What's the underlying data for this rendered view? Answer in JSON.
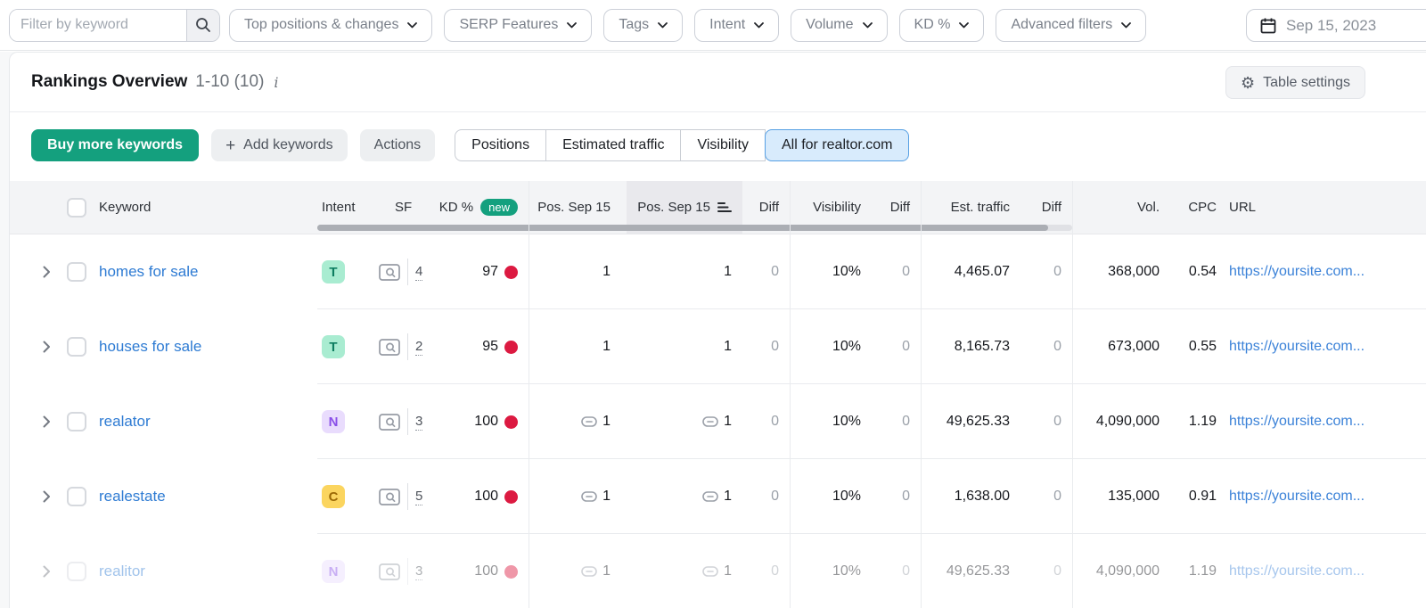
{
  "filters": {
    "keyword_placeholder": "Filter by keyword",
    "dropdowns": [
      {
        "id": "top-positions-changes",
        "label": "Top positions & changes"
      },
      {
        "id": "serp-features",
        "label": "SERP Features"
      },
      {
        "id": "tags",
        "label": "Tags"
      },
      {
        "id": "intent",
        "label": "Intent"
      },
      {
        "id": "volume",
        "label": "Volume"
      },
      {
        "id": "kd",
        "label": "KD %"
      },
      {
        "id": "advanced-filters",
        "label": "Advanced filters"
      }
    ],
    "date": "Sep 15, 2023"
  },
  "overview": {
    "title": "Rankings Overview",
    "range": "1-10 (10)",
    "table_settings_label": "Table settings"
  },
  "actions": {
    "buy_label": "Buy more keywords",
    "add_label": "Add keywords",
    "actions_label": "Actions",
    "view_tabs": [
      {
        "id": "positions",
        "label": "Positions",
        "active": false
      },
      {
        "id": "estimated-traffic",
        "label": "Estimated traffic",
        "active": false
      },
      {
        "id": "visibility",
        "label": "Visibility",
        "active": false
      },
      {
        "id": "all-for-domain",
        "label": "All for realtor.com",
        "active": true
      }
    ]
  },
  "table": {
    "new_badge_label": "new",
    "columns": [
      {
        "id": "keyword",
        "label": "Keyword"
      },
      {
        "id": "intent",
        "label": "Intent"
      },
      {
        "id": "sf",
        "label": "SF"
      },
      {
        "id": "kd",
        "label": "KD %",
        "badge": true
      },
      {
        "id": "pos1",
        "label": "Pos. Sep 15"
      },
      {
        "id": "pos2",
        "label": "Pos. Sep 15",
        "sorted": true
      },
      {
        "id": "diff1",
        "label": "Diff"
      },
      {
        "id": "visibility",
        "label": "Visibility"
      },
      {
        "id": "diff2",
        "label": "Diff"
      },
      {
        "id": "traffic",
        "label": "Est. traffic"
      },
      {
        "id": "diff3",
        "label": "Diff"
      },
      {
        "id": "vol",
        "label": "Vol."
      },
      {
        "id": "cpc",
        "label": "CPC"
      },
      {
        "id": "url",
        "label": "URL"
      }
    ],
    "intent_colors": {
      "T": {
        "bg": "#a9ecd1",
        "fg": "#0d7d60"
      },
      "N": {
        "bg": "#e9dcfd",
        "fg": "#8a4fe8"
      },
      "C": {
        "bg": "#fbd55f",
        "fg": "#9c6a06"
      }
    },
    "kd_dot_color": "#dc1a41",
    "rows": [
      {
        "keyword": "homes for sale",
        "intent": "T",
        "sf": "4",
        "kd": "97",
        "pos1": "1",
        "pos1_linked": false,
        "pos2": "1",
        "pos2_linked": false,
        "diff1": "0",
        "visibility": "10%",
        "diff2": "0",
        "traffic": "4,465.07",
        "diff3": "0",
        "vol": "368,000",
        "cpc": "0.54",
        "url": "https://yoursite.com...",
        "faded": false
      },
      {
        "keyword": "houses for sale",
        "intent": "T",
        "sf": "2",
        "kd": "95",
        "pos1": "1",
        "pos1_linked": false,
        "pos2": "1",
        "pos2_linked": false,
        "diff1": "0",
        "visibility": "10%",
        "diff2": "0",
        "traffic": "8,165.73",
        "diff3": "0",
        "vol": "673,000",
        "cpc": "0.55",
        "url": "https://yoursite.com...",
        "faded": false
      },
      {
        "keyword": "realator",
        "intent": "N",
        "sf": "3",
        "kd": "100",
        "pos1": "1",
        "pos1_linked": true,
        "pos2": "1",
        "pos2_linked": true,
        "diff1": "0",
        "visibility": "10%",
        "diff2": "0",
        "traffic": "49,625.33",
        "diff3": "0",
        "vol": "4,090,000",
        "cpc": "1.19",
        "url": "https://yoursite.com...",
        "faded": false
      },
      {
        "keyword": "realestate",
        "intent": "C",
        "sf": "5",
        "kd": "100",
        "pos1": "1",
        "pos1_linked": true,
        "pos2": "1",
        "pos2_linked": true,
        "diff1": "0",
        "visibility": "10%",
        "diff2": "0",
        "traffic": "1,638.00",
        "diff3": "0",
        "vol": "135,000",
        "cpc": "0.91",
        "url": "https://yoursite.com...",
        "faded": false
      },
      {
        "keyword": "realitor",
        "intent": "N",
        "sf": "3",
        "kd": "100",
        "pos1": "1",
        "pos1_linked": true,
        "pos2": "1",
        "pos2_linked": true,
        "diff1": "0",
        "visibility": "10%",
        "diff2": "0",
        "traffic": "49,625.33",
        "diff3": "0",
        "vol": "4,090,000",
        "cpc": "1.19",
        "url": "https://yoursite.com...",
        "faded": true
      }
    ]
  },
  "colors": {
    "accent_green": "#14a07e",
    "link_blue": "#2e7bd3",
    "url_blue": "#3b82d8",
    "selected_tab_bg": "#d8ebfc",
    "selected_tab_border": "#57a0e4"
  }
}
